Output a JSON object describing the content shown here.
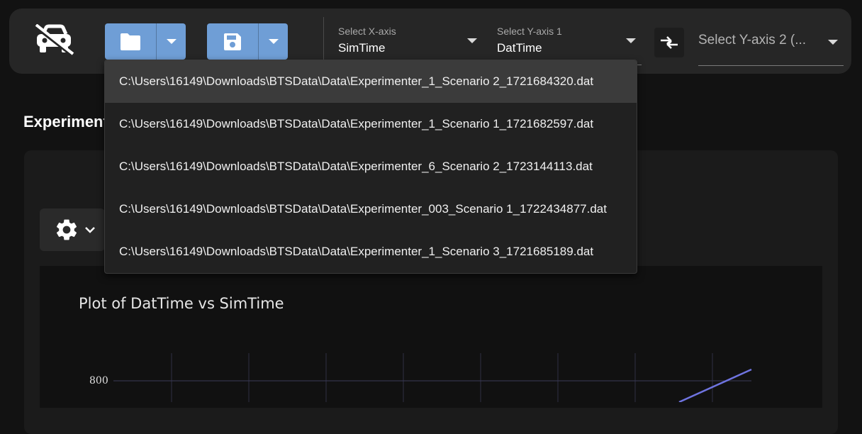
{
  "toolbar": {
    "logo_icon": "car-icon",
    "open_button_icon": "folder-icon",
    "save_button_icon": "floppy-disk-icon",
    "accent_color": "#6f9ed6",
    "x_axis": {
      "label": "Select X-axis",
      "value": "SimTime"
    },
    "y_axis_1": {
      "label": "Select Y-axis 1",
      "value": "DatTime"
    },
    "swap_icon": "swap-axes-icon",
    "y_axis_2": {
      "placeholder": "Select Y-axis 2 (..."
    }
  },
  "recent_files": [
    "C:\\Users\\16149\\Downloads\\BTSData\\Data\\Experimenter_1_Scenario 2_1721684320.dat",
    "C:\\Users\\16149\\Downloads\\BTSData\\Data\\Experimenter_1_Scenario 1_1721682597.dat",
    "C:\\Users\\16149\\Downloads\\BTSData\\Data\\Experimenter_6_Scenario 2_1723144113.dat",
    "C:\\Users\\16149\\Downloads\\BTSData\\Data\\Experimenter_003_Scenario 1_1722434877.dat",
    "C:\\Users\\16149\\Downloads\\BTSData\\Data\\Experimenter_1_Scenario 3_1721685189.dat"
  ],
  "section_title": "Experiment",
  "settings_icon": "gear-icon",
  "chart_data": {
    "type": "line",
    "title": "Plot of DatTime vs SimTime",
    "xlabel": "",
    "ylabel": "",
    "y_ticks": [
      "800"
    ],
    "series_color": "#6f74e0",
    "grid": true
  }
}
